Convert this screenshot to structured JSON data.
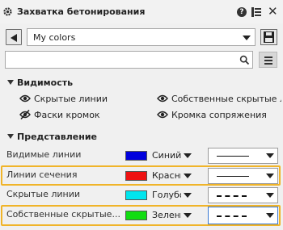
{
  "window": {
    "title": "Захватка бетонирования",
    "help_label": "?",
    "close_label": "✕"
  },
  "preset": {
    "selected": "My colors"
  },
  "search": {
    "value": "",
    "placeholder": ""
  },
  "visibility": {
    "header": "Видимость",
    "items": [
      {
        "label": "Скрытые линии",
        "icon": "eye-icon",
        "visible": true
      },
      {
        "label": "Собственные скрытые ли",
        "icon": "eye-icon",
        "visible": true
      },
      {
        "label": "Фаски кромок",
        "icon": "eye-slash-icon",
        "visible": false
      },
      {
        "label": "Кромка сопряжения",
        "icon": "eye-icon",
        "visible": true
      }
    ]
  },
  "representation": {
    "header": "Представление",
    "rows": [
      {
        "label": "Видимые линии",
        "color_name": "Синий",
        "color": "#0000dd",
        "line_style": "solid"
      },
      {
        "label": "Линии сечения",
        "color_name": "Красный",
        "color": "#ee1111",
        "line_style": "solid",
        "highlighted": true
      },
      {
        "label": "Скрытые линии",
        "color_name": "Голубой",
        "color": "#00e5ee",
        "line_style": "dash"
      },
      {
        "label": "Собственные скрытые...",
        "color_name": "Зеленый",
        "color": "#11dd11",
        "line_style": "dash",
        "highlighted": true,
        "focused": true
      }
    ]
  },
  "colors": {
    "highlight": "#f0b429",
    "focus": "#3a78d2"
  }
}
